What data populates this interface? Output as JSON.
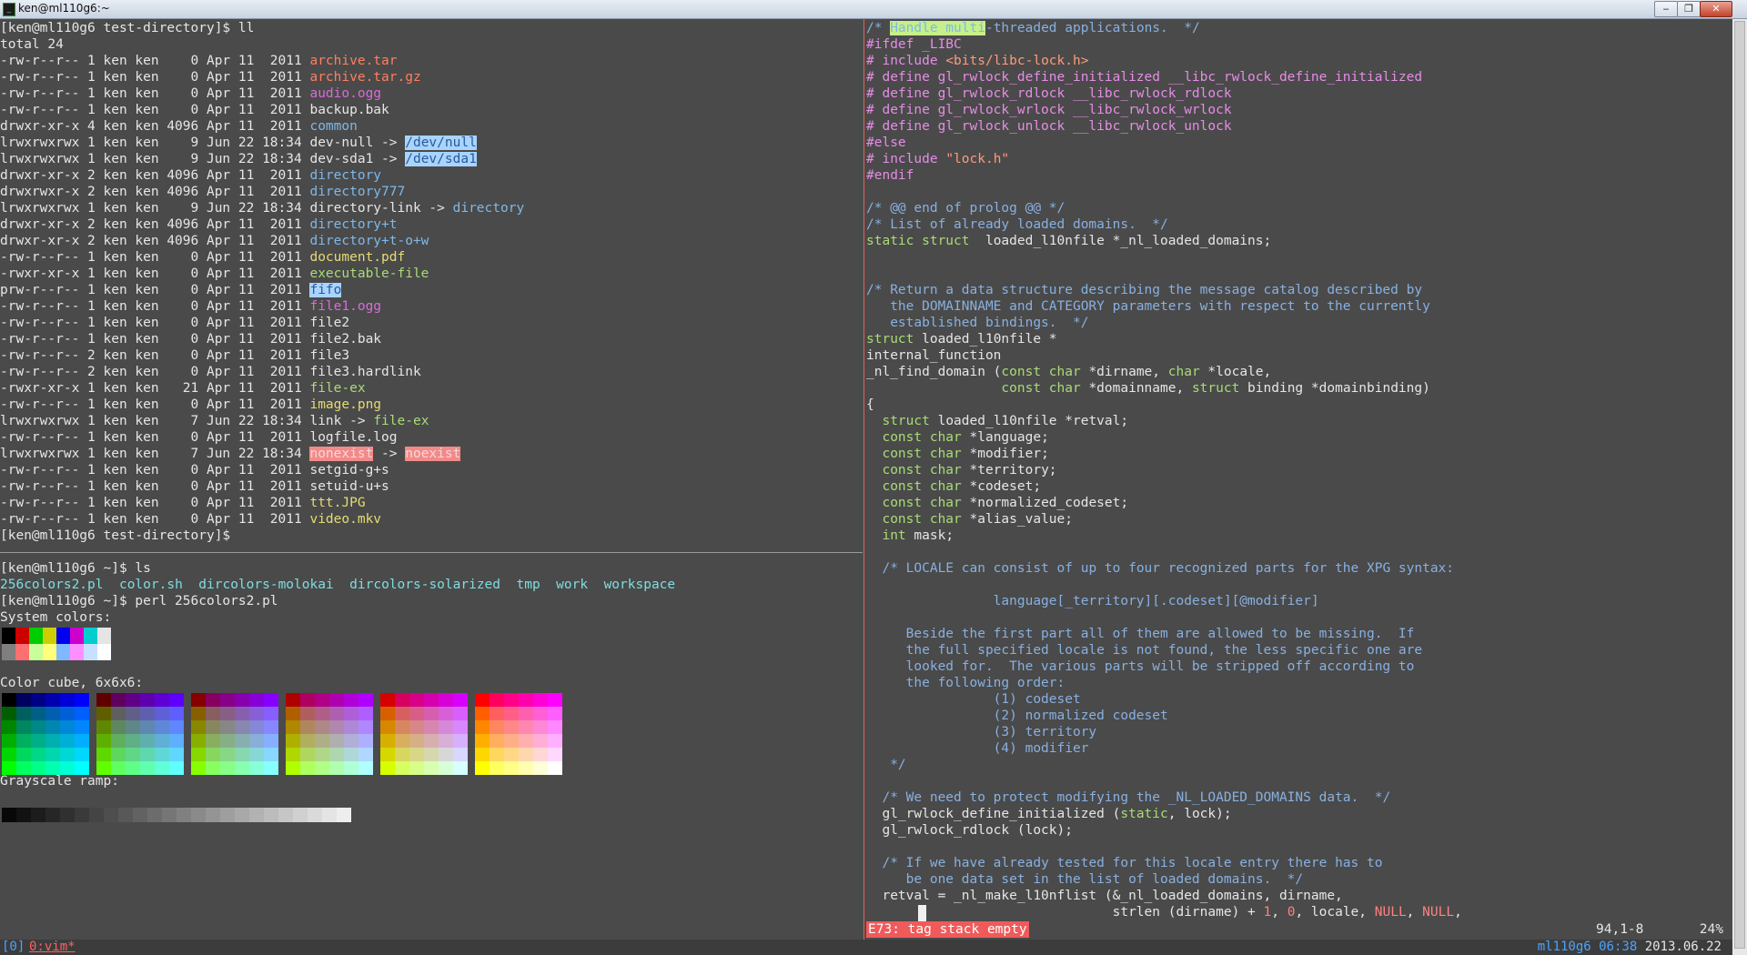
{
  "window": {
    "title": "ken@ml110g6:~",
    "min": "‒",
    "max": "❐",
    "close": "✕"
  },
  "left_top": {
    "prompt1": "[ken@ml110g6 test-directory]$ ll",
    "total": "total 24",
    "rows": [
      {
        "p": "-rw-r--r--",
        "n": "1",
        "s": "0",
        "d": "Apr 11  2011",
        "f": "archive.tar",
        "c": "arc"
      },
      {
        "p": "-rw-r--r--",
        "n": "1",
        "s": "0",
        "d": "Apr 11  2011",
        "f": "archive.tar.gz",
        "c": "arc"
      },
      {
        "p": "-rw-r--r--",
        "n": "1",
        "s": "0",
        "d": "Apr 11  2011",
        "f": "audio.ogg",
        "c": "aud"
      },
      {
        "p": "-rw-r--r--",
        "n": "1",
        "s": "0",
        "d": "Apr 11  2011",
        "f": "backup.bak",
        "c": ""
      },
      {
        "p": "drwxr-xr-x",
        "n": "4",
        "s": "4096",
        "d": "Apr 11  2011",
        "f": "common",
        "c": "dir"
      },
      {
        "p": "lrwxrwxrwx",
        "n": "1",
        "s": "9",
        "d": "Jun 22 18:34",
        "f": "dev-null",
        "c": "",
        "t": "/dev/null",
        "tc": "sym"
      },
      {
        "p": "lrwxrwxrwx",
        "n": "1",
        "s": "9",
        "d": "Jun 22 18:34",
        "f": "dev-sda1",
        "c": "",
        "t": "/dev/sda1",
        "tc": "sym"
      },
      {
        "p": "drwxr-xr-x",
        "n": "2",
        "s": "4096",
        "d": "Apr 11  2011",
        "f": "directory",
        "c": "dir"
      },
      {
        "p": "drwxrwxr-x",
        "n": "2",
        "s": "4096",
        "d": "Apr 11  2011",
        "f": "directory777",
        "c": "dir"
      },
      {
        "p": "lrwxrwxrwx",
        "n": "1",
        "s": "9",
        "d": "Jun 22 18:34",
        "f": "directory-link",
        "c": "",
        "t": "directory",
        "tc": "dir"
      },
      {
        "p": "drwxr-xr-x",
        "n": "2",
        "s": "4096",
        "d": "Apr 11  2011",
        "f": "directory+t",
        "c": "dir"
      },
      {
        "p": "drwxr-xr-x",
        "n": "2",
        "s": "4096",
        "d": "Apr 11  2011",
        "f": "directory+t-o+w",
        "c": "dir"
      },
      {
        "p": "-rw-r--r--",
        "n": "1",
        "s": "0",
        "d": "Apr 11  2011",
        "f": "document.pdf",
        "c": "doc"
      },
      {
        "p": "-rwxr-xr-x",
        "n": "1",
        "s": "0",
        "d": "Apr 11  2011",
        "f": "executable-file",
        "c": "exe"
      },
      {
        "p": "prw-r--r--",
        "n": "1",
        "s": "0",
        "d": "Apr 11  2011",
        "f": "fifo",
        "c": "fifo"
      },
      {
        "p": "-rw-r--r--",
        "n": "1",
        "s": "0",
        "d": "Apr 11  2011",
        "f": "file1.ogg",
        "c": "aud"
      },
      {
        "p": "-rw-r--r--",
        "n": "1",
        "s": "0",
        "d": "Apr 11  2011",
        "f": "file2",
        "c": ""
      },
      {
        "p": "-rw-r--r--",
        "n": "1",
        "s": "0",
        "d": "Apr 11  2011",
        "f": "file2.bak",
        "c": ""
      },
      {
        "p": "-rw-r--r--",
        "n": "2",
        "s": "0",
        "d": "Apr 11  2011",
        "f": "file3",
        "c": ""
      },
      {
        "p": "-rw-r--r--",
        "n": "2",
        "s": "0",
        "d": "Apr 11  2011",
        "f": "file3.hardlink",
        "c": ""
      },
      {
        "p": "-rwxr-xr-x",
        "n": "1",
        "s": "21",
        "d": "Apr 11  2011",
        "f": "file-ex",
        "c": "exe"
      },
      {
        "p": "-rw-r--r--",
        "n": "1",
        "s": "0",
        "d": "Apr 11  2011",
        "f": "image.png",
        "c": "img"
      },
      {
        "p": "lrwxrwxrwx",
        "n": "1",
        "s": "7",
        "d": "Jun 22 18:34",
        "f": "link",
        "c": "",
        "t": "file-ex",
        "tc": "exe"
      },
      {
        "p": "-rw-r--r--",
        "n": "1",
        "s": "0",
        "d": "Apr 11  2011",
        "f": "logfile.log",
        "c": ""
      },
      {
        "p": "lrwxrwxrwx",
        "n": "1",
        "s": "7",
        "d": "Jun 22 18:34",
        "f": "nonexist",
        "c": "bad",
        "t": "noexist",
        "tc": "bad"
      },
      {
        "p": "-rw-r--r--",
        "n": "1",
        "s": "0",
        "d": "Apr 11  2011",
        "f": "setgid-g+s",
        "c": ""
      },
      {
        "p": "-rw-r--r--",
        "n": "1",
        "s": "0",
        "d": "Apr 11  2011",
        "f": "setuid-u+s",
        "c": ""
      },
      {
        "p": "-rw-r--r--",
        "n": "1",
        "s": "0",
        "d": "Apr 11  2011",
        "f": "ttt.JPG",
        "c": "img"
      },
      {
        "p": "-rw-r--r--",
        "n": "1",
        "s": "0",
        "d": "Apr 11  2011",
        "f": "video.mkv",
        "c": "doc"
      }
    ],
    "owner": "ken",
    "group": "ken",
    "prompt2": "[ken@ml110g6 test-directory]$"
  },
  "left_bottom": {
    "prompt_ls": "[ken@ml110g6 ~]$ ls",
    "ls_items": [
      "256colors2.pl",
      "color.sh",
      "dircolors-molokai",
      "dircolors-solarized",
      "tmp",
      "work",
      "workspace"
    ],
    "prompt_perl": "[ken@ml110g6 ~]$ perl 256colors2.pl",
    "system_label": "System colors:",
    "cube_label": "Color cube, 6x6x6:",
    "gray_label": "Grayscale ramp:",
    "prompt_end": "[ken@ml110g6 ~]$"
  },
  "vim_lines": [
    [
      [
        "vc",
        "/* "
      ],
      [
        "vhl",
        "Handle multi"
      ],
      [
        "vc",
        "-threaded applications.  */"
      ]
    ],
    [
      [
        "vp",
        "#ifdef _LIBC"
      ]
    ],
    [
      [
        "vp",
        "# include "
      ],
      [
        "vs",
        "<bits/libc-lock.h>"
      ]
    ],
    [
      [
        "vp",
        "# define gl_rwlock_define_initialized __libc_rwlock_define_initialized"
      ]
    ],
    [
      [
        "vp",
        "# define gl_rwlock_rdlock __libc_rwlock_rdlock"
      ]
    ],
    [
      [
        "vp",
        "# define gl_rwlock_wrlock __libc_rwlock_wrlock"
      ]
    ],
    [
      [
        "vp",
        "# define gl_rwlock_unlock __libc_rwlock_unlock"
      ]
    ],
    [
      [
        "vp",
        "#else"
      ]
    ],
    [
      [
        "vp",
        "# include "
      ],
      [
        "vs",
        "\"lock.h\""
      ]
    ],
    [
      [
        "vp",
        "#endif"
      ]
    ],
    [],
    [
      [
        "vc",
        "/* @@ end of prolog @@ */"
      ]
    ],
    [
      [
        "vc",
        "/* List of already loaded domains.  */"
      ]
    ],
    [
      [
        "vk",
        "static struct"
      ],
      [
        "",
        "  loaded_l10nfile *_nl_loaded_domains;"
      ]
    ],
    [],
    [],
    [
      [
        "vc",
        "/* Return a data structure describing the message catalog described by"
      ]
    ],
    [
      [
        "vc",
        "   the DOMAINNAME and CATEGORY parameters with respect to the currently"
      ]
    ],
    [
      [
        "vc",
        "   established bindings.  */"
      ]
    ],
    [
      [
        "vk",
        "struct"
      ],
      [
        "",
        " loaded_l10nfile *"
      ]
    ],
    [
      [
        "",
        "internal_function"
      ]
    ],
    [
      [
        "",
        "_nl_find_domain ("
      ],
      [
        "vt",
        "const char"
      ],
      [
        "",
        " *dirname, "
      ],
      [
        "vt",
        "char"
      ],
      [
        "",
        " *locale,"
      ]
    ],
    [
      [
        "",
        "                 "
      ],
      [
        "vt",
        "const char"
      ],
      [
        "",
        " *domainname, "
      ],
      [
        "vk",
        "struct"
      ],
      [
        "",
        " binding *domainbinding)"
      ]
    ],
    [
      [
        "",
        "{"
      ]
    ],
    [
      [
        "",
        "  "
      ],
      [
        "vk",
        "struct"
      ],
      [
        "",
        " loaded_l10nfile *retval;"
      ]
    ],
    [
      [
        "",
        "  "
      ],
      [
        "vt",
        "const char"
      ],
      [
        "",
        " *language;"
      ]
    ],
    [
      [
        "",
        "  "
      ],
      [
        "vt",
        "const char"
      ],
      [
        "",
        " *modifier;"
      ]
    ],
    [
      [
        "",
        "  "
      ],
      [
        "vt",
        "const char"
      ],
      [
        "",
        " *territory;"
      ]
    ],
    [
      [
        "",
        "  "
      ],
      [
        "vt",
        "const char"
      ],
      [
        "",
        " *codeset;"
      ]
    ],
    [
      [
        "",
        "  "
      ],
      [
        "vt",
        "const char"
      ],
      [
        "",
        " *normalized_codeset;"
      ]
    ],
    [
      [
        "",
        "  "
      ],
      [
        "vt",
        "const char"
      ],
      [
        "",
        " *alias_value;"
      ]
    ],
    [
      [
        "",
        "  "
      ],
      [
        "vt",
        "int"
      ],
      [
        "",
        " mask;"
      ]
    ],
    [],
    [
      [
        "",
        "  "
      ],
      [
        "vc",
        "/* LOCALE can consist of up to four recognized parts for the XPG syntax:"
      ]
    ],
    [],
    [
      [
        "vc",
        "                language[_territory][.codeset][@modifier]"
      ]
    ],
    [],
    [
      [
        "vc",
        "     Beside the first part all of them are allowed to be missing.  If"
      ]
    ],
    [
      [
        "vc",
        "     the full specified locale is not found, the less specific one are"
      ]
    ],
    [
      [
        "vc",
        "     looked for.  The various parts will be stripped off according to"
      ]
    ],
    [
      [
        "vc",
        "     the following order:"
      ]
    ],
    [
      [
        "vc",
        "                (1) codeset"
      ]
    ],
    [
      [
        "vc",
        "                (2) normalized codeset"
      ]
    ],
    [
      [
        "vc",
        "                (3) territory"
      ]
    ],
    [
      [
        "vc",
        "                (4) modifier"
      ]
    ],
    [
      [
        "vc",
        "   */"
      ]
    ],
    [],
    [
      [
        "",
        "  "
      ],
      [
        "vc",
        "/* We need to protect modifying the _NL_LOADED_DOMAINS data.  */"
      ]
    ],
    [
      [
        "",
        "  gl_rwlock_define_initialized ("
      ],
      [
        "vk",
        "static"
      ],
      [
        "",
        ", lock);"
      ]
    ],
    [
      [
        "",
        "  gl_rwlock_rdlock (lock);"
      ]
    ],
    [],
    [
      [
        "",
        "  "
      ],
      [
        "vc",
        "/* If we have already tested for this locale entry there has to"
      ]
    ],
    [
      [
        "vc",
        "     be one data set in the list of loaded domains.  */"
      ]
    ],
    [
      [
        "",
        "  retval = _nl_make_l10nflist (&_nl_loaded_domains, dirname,"
      ]
    ],
    [
      [
        "",
        "                               strlen (dirname) + "
      ],
      [
        "vn",
        "1"
      ],
      [
        "",
        ", "
      ],
      [
        "vn",
        "0"
      ],
      [
        "",
        ", locale, "
      ],
      [
        "vn",
        "NULL"
      ],
      [
        "",
        ", "
      ],
      [
        "vn",
        "NULL"
      ],
      [
        "",
        ","
      ]
    ]
  ],
  "vim_status": {
    "message": "E73: tag stack empty",
    "position": "94,1-8",
    "percent": "24%"
  },
  "tmux": {
    "session": "[0]",
    "window": "0:vim*",
    "host_time": "ml110g6 06:38",
    "date": "2013.06.22"
  },
  "colors": {
    "background": "#4a4a4a",
    "text": "#e6e6e6",
    "error": "#f05a5a"
  }
}
